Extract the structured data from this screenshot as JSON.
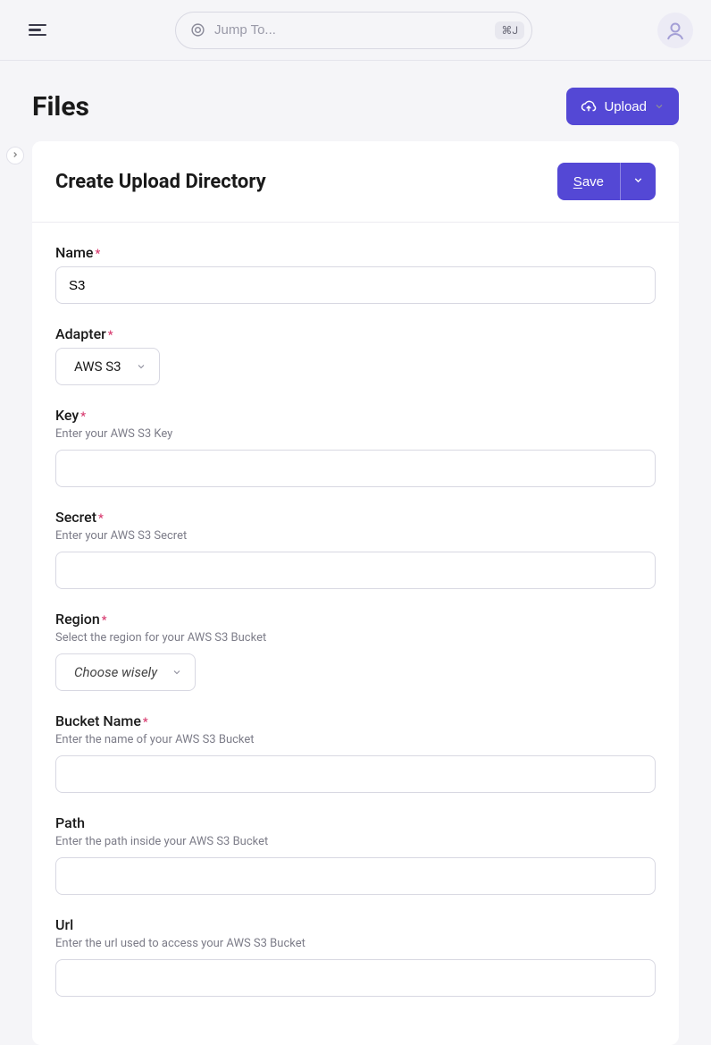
{
  "header": {
    "search_placeholder": "Jump To...",
    "kbd": "⌘J"
  },
  "page": {
    "title": "Files",
    "upload_label": "Upload"
  },
  "card": {
    "title": "Create Upload Directory",
    "save_label_underlined": "S",
    "save_label_rest": "ave"
  },
  "form": {
    "name": {
      "label": "Name",
      "value": "S3",
      "required": true
    },
    "adapter": {
      "label": "Adapter",
      "value": "AWS S3",
      "required": true
    },
    "key": {
      "label": "Key",
      "help": "Enter your AWS S3 Key",
      "value": "",
      "required": true
    },
    "secret": {
      "label": "Secret",
      "help": "Enter your AWS S3 Secret",
      "value": "",
      "required": true
    },
    "region": {
      "label": "Region",
      "help": "Select the region for your AWS S3 Bucket",
      "placeholder": "Choose wisely",
      "required": true
    },
    "bucket": {
      "label": "Bucket Name",
      "help": "Enter the name of your AWS S3 Bucket",
      "value": "",
      "required": true
    },
    "path": {
      "label": "Path",
      "help": "Enter the path inside your AWS S3 Bucket",
      "value": "",
      "required": false
    },
    "url": {
      "label": "Url",
      "help": "Enter the url used to access your AWS S3 Bucket",
      "value": "",
      "required": false
    }
  },
  "required_mark": "*"
}
